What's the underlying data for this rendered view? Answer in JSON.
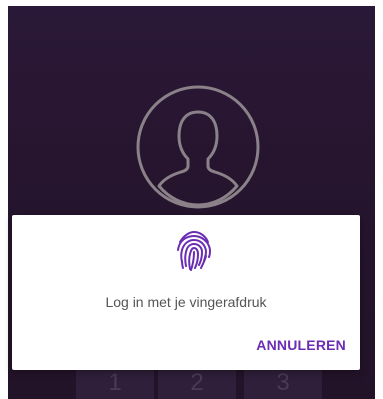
{
  "keypad": {
    "keys": [
      "1",
      "2",
      "3"
    ]
  },
  "dialog": {
    "message": "Log in met je vingerafdruk",
    "cancel_label": "ANNULEREN",
    "icon": "fingerprint-icon"
  },
  "colors": {
    "background": "#27152f",
    "accent": "#6a2db3",
    "dialog_bg": "#ffffff",
    "message_text": "#555555"
  },
  "avatar": {
    "icon": "user-avatar-icon"
  }
}
